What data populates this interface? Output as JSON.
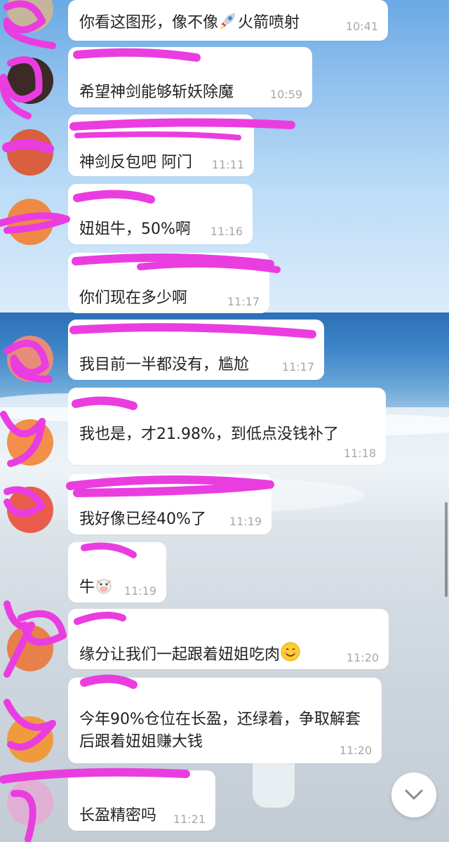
{
  "colors": {
    "bubble": "#ffffff",
    "scribble": "#ea3de0",
    "timestamp": "#a8a8a8",
    "text": "#222222"
  },
  "messages": [
    {
      "text": "你看这图形，像不像",
      "text_after": "火箭喷射",
      "emoji": "rocket-emoji",
      "time": "10:41"
    },
    {
      "text": "希望神剑能够斩妖除魔",
      "time": "10:59"
    },
    {
      "text": "神剑反包吧 阿门",
      "time": "11:11"
    },
    {
      "text": "妞姐牛，50%啊",
      "time": "11:16"
    },
    {
      "text": "你们现在多少啊",
      "time": "11:17"
    },
    {
      "text": "我目前一半都没有，尴尬",
      "time": "11:17"
    },
    {
      "text": "我也是，才21.98%，到低点没钱补了",
      "time": "11:18"
    },
    {
      "text": "我好像已经40%了",
      "time": "11:19"
    },
    {
      "text": "牛",
      "emoji": "cow-face-emoji",
      "time": "11:19"
    },
    {
      "text": "缘分让我们一起跟着妞姐吃肉",
      "emoji": "smiling-face-emoji",
      "time": "11:20"
    },
    {
      "text": "今年90%仓位在长盈，还绿着，争取解套后跟着妞姐赚大钱",
      "time": "11:20"
    },
    {
      "text": "长盈精密吗",
      "time": "11:21"
    }
  ],
  "scroll_button": {
    "icon": "chevron-down-icon"
  }
}
